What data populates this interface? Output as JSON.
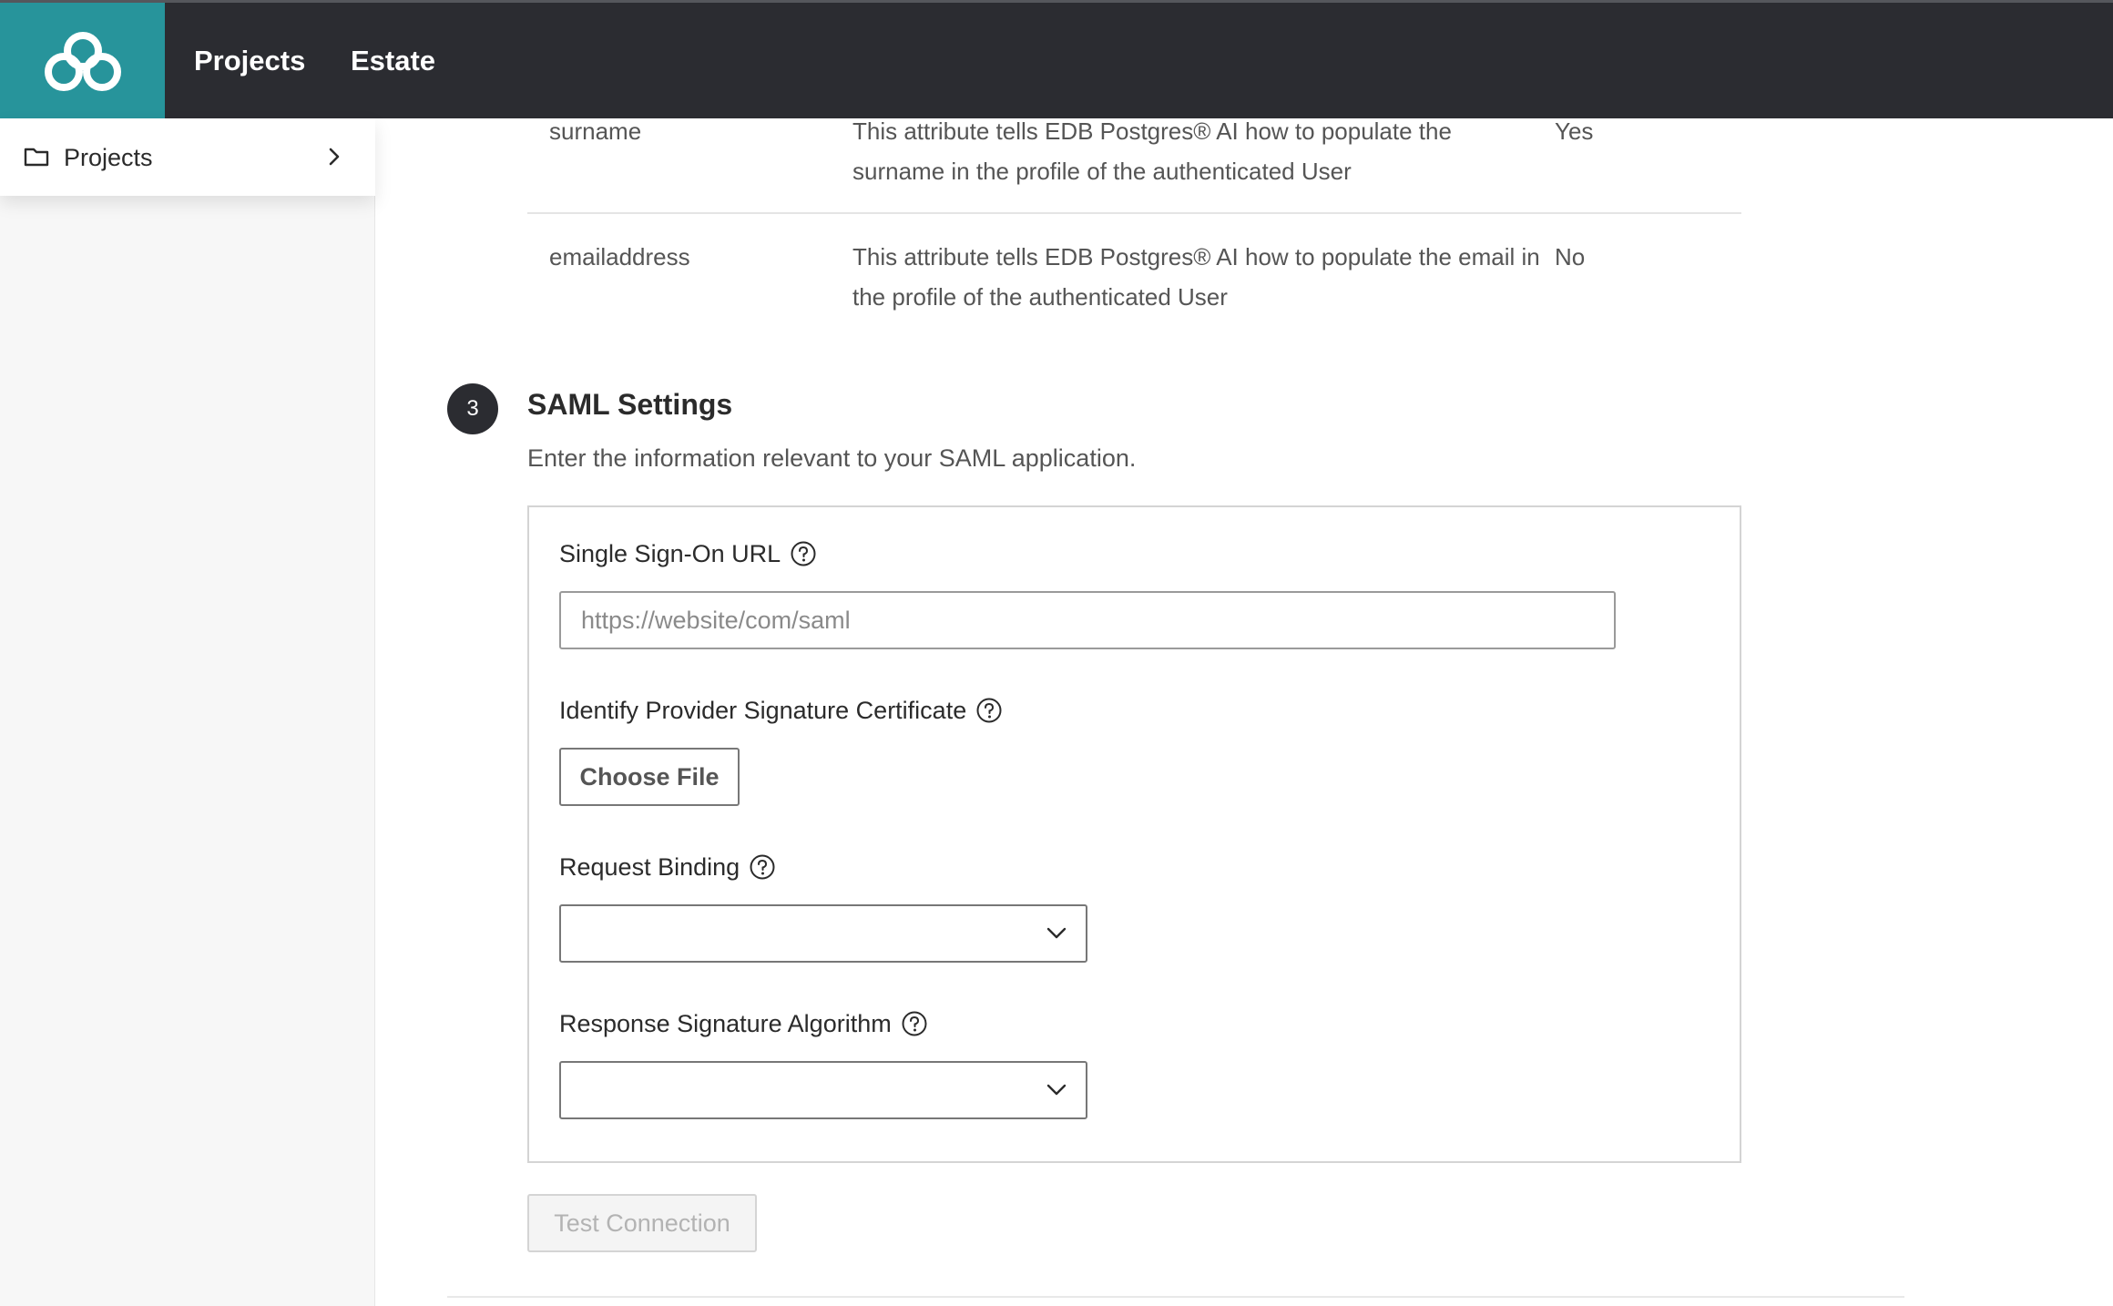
{
  "header": {
    "nav": [
      "Projects",
      "Estate"
    ]
  },
  "sidebar": {
    "items": [
      {
        "label": "Projects"
      }
    ]
  },
  "attributes": [
    {
      "name": "surname",
      "description": "This attribute tells EDB Postgres® AI how to populate the surname in the profile of the authenticated User",
      "required": "Yes"
    },
    {
      "name": "emailaddress",
      "description": "This attribute tells EDB Postgres® AI how to populate the email in the profile of the authenticated User",
      "required": "No"
    }
  ],
  "saml": {
    "step_number": "3",
    "title": "SAML Settings",
    "subtitle": "Enter the information relevant to your SAML application.",
    "sso_url_label": "Single Sign-On URL",
    "sso_url_placeholder": "https://website/com/saml",
    "sso_url_value": "",
    "certificate_label": "Identify Provider Signature Certificate",
    "choose_file_label": "Choose File",
    "request_binding_label": "Request Binding",
    "request_binding_value": "",
    "response_algorithm_label": "Response Signature Algorithm",
    "response_algorithm_value": "",
    "test_connection_label": "Test Connection"
  },
  "colors": {
    "topbar": "#2b2c31",
    "brand": "#27949b",
    "step_circle": "#2b2c31"
  },
  "icons": {
    "logo": "edb-cloud-logo-icon",
    "folder": "folder-icon",
    "chevron": "chevron-right-icon",
    "help": "help-circle-icon",
    "select_caret": "chevron-down-icon"
  }
}
